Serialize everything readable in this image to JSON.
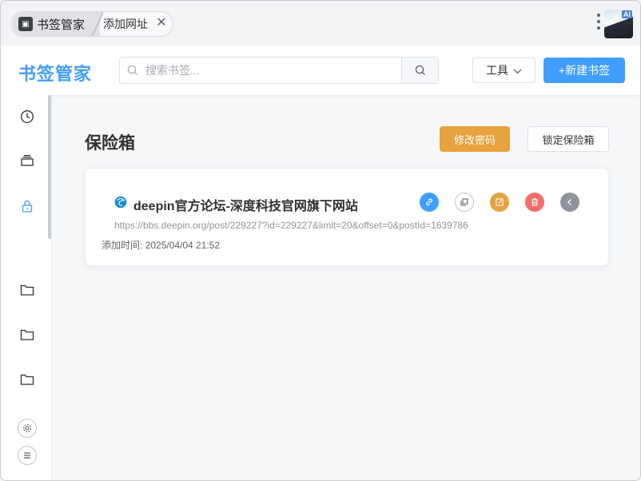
{
  "browser": {
    "active_tab": "书签管家",
    "inactive_tab": "添加网址",
    "ext_badge": "AI"
  },
  "header": {
    "brand": "书签管家",
    "search_placeholder": "搜索书签...",
    "tools_label": "工具",
    "new_bookmark_label": "+新建书签"
  },
  "sidebar": {
    "items": [
      "recent-icon",
      "collection-icon",
      "vault-lock-icon",
      "folder-icon",
      "folder-icon",
      "folder-icon"
    ],
    "active": "vault-lock-icon"
  },
  "vault": {
    "title": "保险箱",
    "change_password": "修改密码",
    "lock_vault": "锁定保险箱"
  },
  "bookmark": {
    "title": "deepin官方论坛-深度科技官网旗下网站",
    "url": "https://bbs.deepin.org/post/229227?id=229227&limit=20&offset=0&postId=1639786",
    "added_time": "添加时间: 2025/04/04 21:52"
  },
  "colors": {
    "primary": "#409eff",
    "warning": "#e6a23c",
    "danger": "#f56c6c",
    "info": "#909399"
  }
}
